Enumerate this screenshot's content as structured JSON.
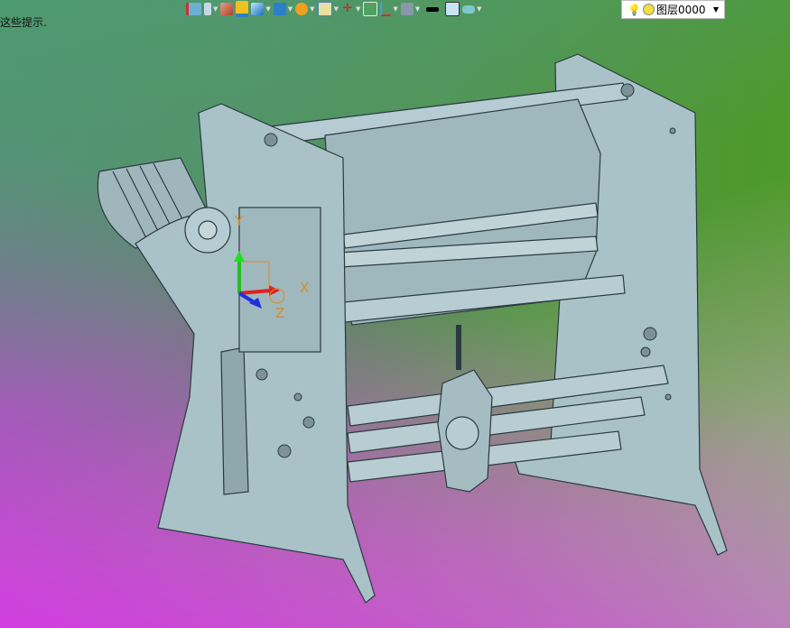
{
  "hint_text": "这些提示.",
  "toolbar": {
    "icons": [
      "wcs-icon",
      "lamp-icon",
      "paint-brush-icon",
      "open-box-icon",
      "shaded-cube-icon",
      "view-orient-icon",
      "render-style-icon",
      "zoom-view-icon",
      "snap-point-icon",
      "sketch-icon",
      "section-view-icon",
      "monitor-icon",
      "line-color-icon",
      "fill-color-icon",
      "layer-stack-icon"
    ],
    "layer_label": "图层0000"
  },
  "viewport": {
    "triad": {
      "x": "X",
      "y": "Y",
      "z": "Z"
    },
    "model_color": "#a9c2c8"
  }
}
